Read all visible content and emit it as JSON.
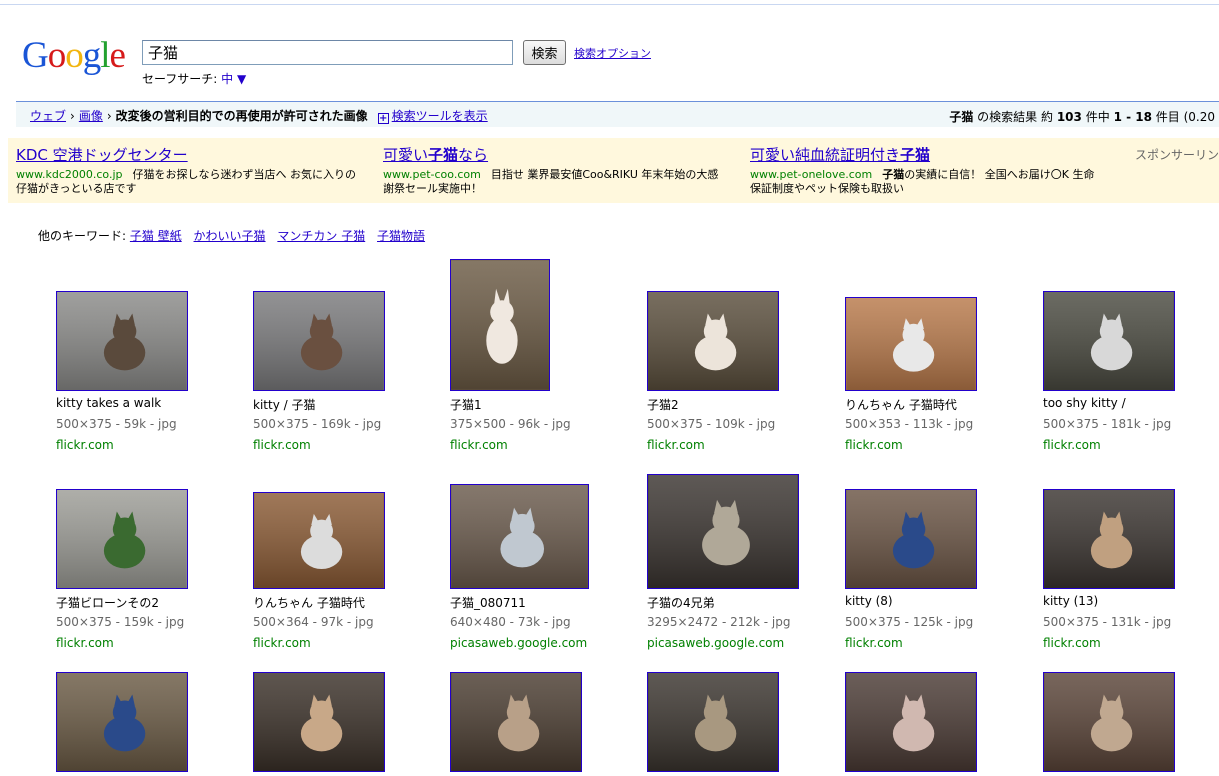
{
  "logo": {
    "letters": [
      "G",
      "o",
      "o",
      "g",
      "l",
      "e"
    ]
  },
  "search": {
    "query": "子猫",
    "button_label": "検索",
    "options_label": "検索オプション"
  },
  "safesearch": {
    "label": "セーフサーチ:",
    "value": "中",
    "arrow": "▼"
  },
  "bar": {
    "crumb_web": "ウェブ",
    "crumb_images": "画像",
    "filter_text": "改変後の営利目的での再使用が許可された画像",
    "tools_label": "検索ツールを表示",
    "results_prefix": "子猫",
    "results_text_1": "の検索結果 約",
    "results_count": "103",
    "results_text_2": "件中",
    "results_range": "1 - 18",
    "results_text_3": "件目 (0.20"
  },
  "ads": {
    "sponsor_label": "スポンサーリン",
    "items": [
      {
        "title": "KDC 空港ドッグセンター",
        "url": "www.kdc2000.co.jp",
        "body": "仔猫をお探しなら迷わず当店へ お気に入りの仔猫がきっといる店です"
      },
      {
        "title_pre": "可愛い",
        "title_bold": "子猫",
        "title_post": "なら",
        "url": "www.pet-coo.com",
        "body": "目指せ 業界最安値Coo&RIKU 年末年始の大感謝祭セール実施中！"
      },
      {
        "title_pre": "可愛い純血統証明付き",
        "title_bold": "子猫",
        "title_post": "",
        "url": "www.pet-onelove.com",
        "body_bold": "子猫",
        "body": "の実績に自信！ 全国へお届け〇K 生命保証制度やペット保険も取扱い"
      }
    ]
  },
  "keywords": {
    "label": "他のキーワード:",
    "items": [
      "子猫 壁紙",
      "かわいい子猫",
      "マンチカン 子猫",
      "子猫物語"
    ]
  },
  "results": [
    {
      "caption": "kitty takes a walk",
      "meta": "500×375 - 59k - jpg",
      "site": "flickr.com",
      "bg": "#8a8a88",
      "fg": "#5a4a3c"
    },
    {
      "caption": "kitty / 子猫",
      "meta": "500×375 - 169k - jpg",
      "site": "flickr.com",
      "bg": "#7a7a7c",
      "fg": "#6a5040"
    },
    {
      "caption": "子猫1",
      "meta": "375×500 - 96k - jpg",
      "site": "flickr.com",
      "bg": "#6b5a44",
      "fg": "#f0e8e0"
    },
    {
      "caption": "子猫2",
      "meta": "500×375 - 109k - jpg",
      "site": "flickr.com",
      "bg": "#5a4e3c",
      "fg": "#ece4da"
    },
    {
      "caption": "りんちゃん 子猫時代",
      "meta": "500×353 - 113k - jpg",
      "site": "flickr.com",
      "bg": "#b8794a",
      "fg": "#e8e8e8"
    },
    {
      "caption": "too shy kitty /",
      "meta": "500×375 - 181k - jpg",
      "site": "flickr.com",
      "bg": "#4a4a40",
      "fg": "#d8d8d8"
    },
    {
      "caption": "子猫ビローンその2",
      "meta": "500×375 - 159k - jpg",
      "site": "flickr.com",
      "bg": "#9c9c96",
      "fg": "#3a6a30"
    },
    {
      "caption": "りんちゃん 子猫時代",
      "meta": "500×364 - 97k - jpg",
      "site": "flickr.com",
      "bg": "#8a5a34",
      "fg": "#dcdcdc"
    },
    {
      "caption": "子猫_080711",
      "meta": "640×480 - 73k - jpg",
      "site": "picasaweb.google.com",
      "bg": "#6a5a4c",
      "fg": "#c0c8d0"
    },
    {
      "caption": "子猫の4兄弟",
      "meta": "3295×2472 - 212k - jpg",
      "site": "picasaweb.google.com",
      "bg": "#3a3430",
      "fg": "#b0a898"
    },
    {
      "caption": "kitty (8)",
      "meta": "500×375 - 125k - jpg",
      "site": "flickr.com",
      "bg": "#6a5444",
      "fg": "#2a4a8a"
    },
    {
      "caption": "kitty (13)",
      "meta": "500×375 - 131k - jpg",
      "site": "flickr.com",
      "bg": "#3a3430",
      "fg": "#c0a080"
    },
    {
      "caption": "",
      "meta": "",
      "site": "",
      "bg": "#6a5a44",
      "fg": "#2a4a8a"
    },
    {
      "caption": "",
      "meta": "",
      "site": "",
      "bg": "#3a3028",
      "fg": "#c8a888"
    },
    {
      "caption": "",
      "meta": "",
      "site": "",
      "bg": "#4a3c30",
      "fg": "#b8a088"
    },
    {
      "caption": "",
      "meta": "",
      "site": "",
      "bg": "#3a342e",
      "fg": "#a89880"
    },
    {
      "caption": "",
      "meta": "",
      "site": "",
      "bg": "#4a3a34",
      "fg": "#d0b8b0"
    },
    {
      "caption": "",
      "meta": "",
      "site": "",
      "bg": "#5a4438",
      "fg": "#c0a890"
    }
  ]
}
